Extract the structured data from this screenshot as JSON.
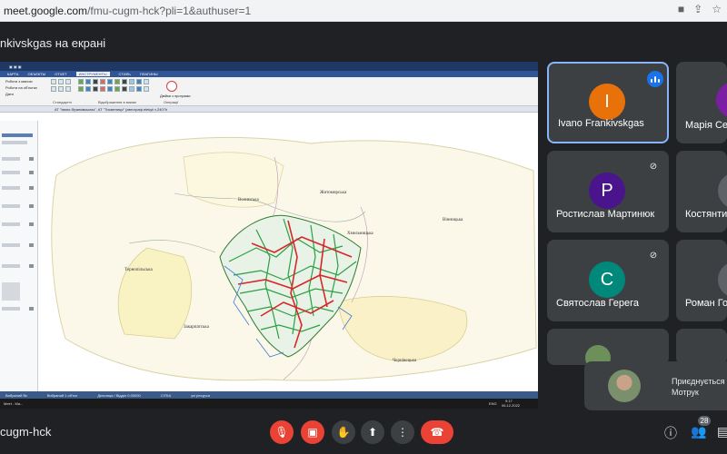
{
  "browser": {
    "url_host": "meet.google.com",
    "url_path": "/fmu-cugm-hck?pli=1&authuser=1"
  },
  "presentation": {
    "title": "nkivskgas на екрані"
  },
  "shared_app": {
    "ribbon_tabs": [
      "КАРТА",
      "ОБЪЕКТЫ",
      "ОТЧЕТ",
      "ИНСТРУМЕНТЫ",
      "СТИЛЬ",
      "ПЛАГИНЫ"
    ],
    "active_tab": "ИНСТРУМЕНТЫ",
    "ribbon_groups": [
      "Стандартні",
      "Відображення в мапах",
      "Операції"
    ],
    "ribbon_menus": [
      "Роботи з мапою",
      "Робота на об'єктах",
      "Дати"
    ],
    "plan_button": "Двійки з програми",
    "doc_tab": "АТ \"Івано-Франківськгаз\", АТ \"Тисмениця\" (автограф.еlеkуіі v.2407h",
    "map_labels": {
      "volynska": "Волинська",
      "zhytomyrska": "Житомирська",
      "khmelnytska": "Хмельницька",
      "vinnytska": "Вінницька",
      "ternopilska": "Тернопільська",
      "zakarpatska": "Закарпатська",
      "chernivetska": "Чернівецька"
    },
    "status_items": [
      "Вибраний №",
      "Вибраний 1 об'єкт",
      "Дільниця / Відділ 0.00000",
      "СІТКА",
      "усі ресурси"
    ],
    "taskbar_left": "Meet - Ма...",
    "taskbar_lang": "ENG",
    "taskbar_time": "9:17",
    "taskbar_date": "06.12.2022"
  },
  "participants": [
    {
      "name": "Ivano Frankivskgas",
      "initial": "I",
      "color": "#e8710a",
      "state": "speaking"
    },
    {
      "name": "Марія Серо",
      "initial": "",
      "color": "#7b1fa2",
      "state": "none"
    },
    {
      "name": "Ростислав Мартинюк",
      "initial": "P",
      "color": "#4a148c",
      "state": "muted"
    },
    {
      "name": "Костянтин",
      "initial": "",
      "color": "#5f6368",
      "state": "none"
    },
    {
      "name": "Святослав Герега",
      "initial": "C",
      "color": "#00897b",
      "state": "muted"
    },
    {
      "name": "Роман Горн",
      "initial": "",
      "color": "#5f6368",
      "state": "none"
    }
  ],
  "join_notice": {
    "line1": "Приєднується",
    "line2": "Мотрук"
  },
  "meeting_code": "cugm-hck",
  "people_count": "28",
  "colors": {
    "accent_blue": "#1a73e8",
    "end_call_red": "#ea4335",
    "tile_bg": "#3c4043"
  }
}
